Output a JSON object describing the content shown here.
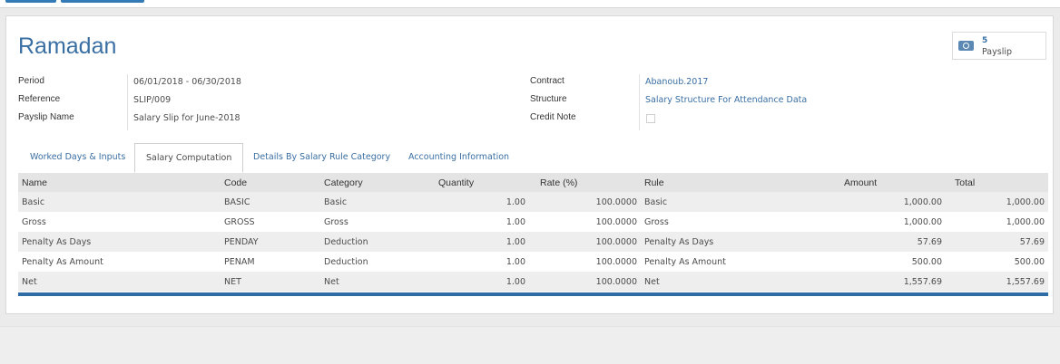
{
  "form": {
    "title": "Ramadan",
    "smart_button": {
      "count": "5",
      "label": "Payslip",
      "icon": "money-icon"
    },
    "left_fields": [
      {
        "label": "Period",
        "value": "06/01/2018 - 06/30/2018"
      },
      {
        "label": "Reference",
        "value": "SLIP/009"
      },
      {
        "label": "Payslip Name",
        "value": "Salary Slip for June-2018"
      }
    ],
    "right_fields": [
      {
        "label": "Contract",
        "value": "Abanoub.2017"
      },
      {
        "label": "Structure",
        "value": "Salary Structure For Attendance Data"
      },
      {
        "label": "Credit Note",
        "value": ""
      }
    ]
  },
  "tabs": [
    {
      "label": "Worked Days & Inputs"
    },
    {
      "label": "Salary Computation"
    },
    {
      "label": "Details By Salary Rule Category"
    },
    {
      "label": "Accounting Information"
    }
  ],
  "table": {
    "headers": [
      "Name",
      "Code",
      "Category",
      "Quantity",
      "Rate (%)",
      "Rule",
      "Amount",
      "Total"
    ],
    "rows": [
      [
        "Basic",
        "BASIC",
        "Basic",
        "1.00",
        "100.0000",
        "Basic",
        "1,000.00",
        "1,000.00"
      ],
      [
        "Gross",
        "GROSS",
        "Gross",
        "1.00",
        "100.0000",
        "Gross",
        "1,000.00",
        "1,000.00"
      ],
      [
        "Penalty As Days",
        "PENDAY",
        "Deduction",
        "1.00",
        "100.0000",
        "Penalty As Days",
        "57.69",
        "57.69"
      ],
      [
        "Penalty As Amount",
        "PENAM",
        "Deduction",
        "1.00",
        "100.0000",
        "Penalty As Amount",
        "500.00",
        "500.00"
      ],
      [
        "Net",
        "NET",
        "Net",
        "1.00",
        "100.0000",
        "Net",
        "1,557.69",
        "1,557.69"
      ]
    ]
  },
  "colors": {
    "accent": "#3a6fa3",
    "bar": "#2f6ca6"
  }
}
